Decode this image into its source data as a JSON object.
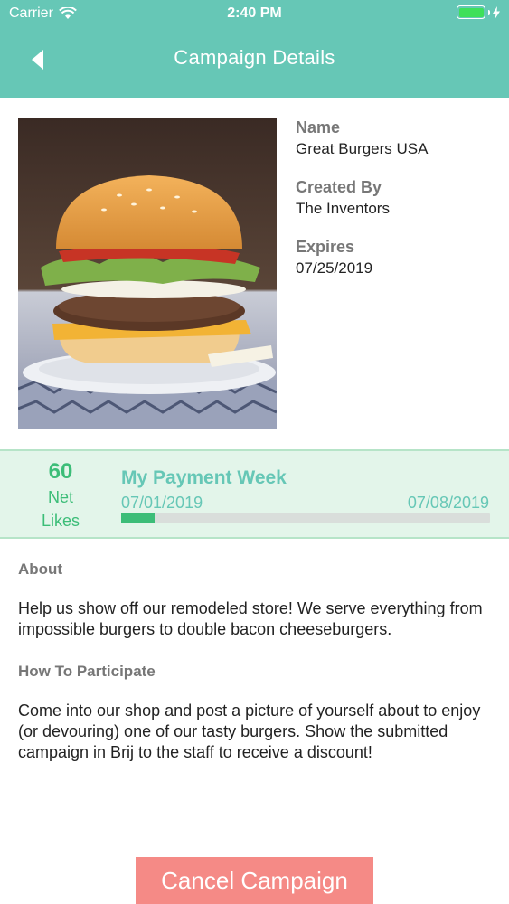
{
  "status_bar": {
    "carrier": "Carrier",
    "time": "2:40 PM"
  },
  "nav": {
    "title": "Campaign Details"
  },
  "campaign": {
    "name_label": "Name",
    "name": "Great Burgers USA",
    "created_by_label": "Created By",
    "created_by": "The Inventors",
    "expires_label": "Expires",
    "expires": "07/25/2019"
  },
  "payment": {
    "likes_count": "60",
    "likes_label_1": "Net",
    "likes_label_2": "Likes",
    "title": "My Payment Week",
    "start_date": "07/01/2019",
    "end_date": "07/08/2019",
    "progress": 0.09
  },
  "about": {
    "title": "About",
    "body": "Help us show off our remodeled store! We serve everything from impossible burgers to double bacon cheeseburgers."
  },
  "how_to": {
    "title": "How To Participate",
    "body": "Come into our shop and post a picture of yourself about to enjoy (or devouring) one of our tasty burgers. Show the submitted campaign in Brij to the staff to receive a discount!"
  },
  "actions": {
    "cancel_label": "Cancel Campaign"
  },
  "colors": {
    "header": "#66c7b6",
    "accent_green": "#3cbd78",
    "cancel": "#f58a86"
  }
}
